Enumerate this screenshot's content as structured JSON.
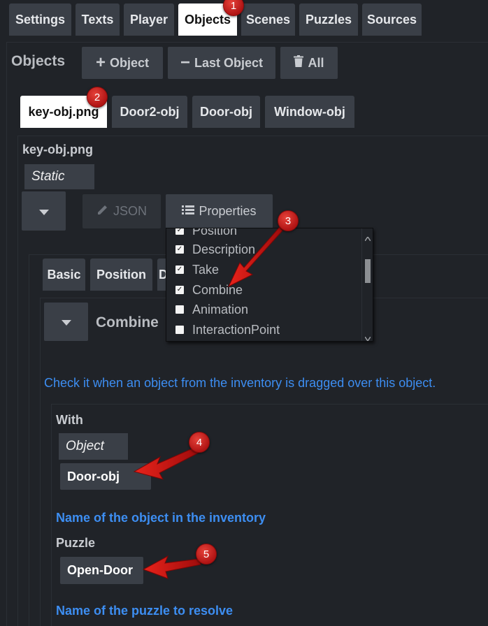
{
  "top_tabs": [
    "Settings",
    "Texts",
    "Player",
    "Objects",
    "Scenes",
    "Puzzles",
    "Sources"
  ],
  "objects_header": {
    "title": "Objects",
    "add_label": "Object",
    "last_label": "Last Object",
    "all_label": "All"
  },
  "object_tabs": [
    "key-obj.png",
    "Door2-obj",
    "Door-obj",
    "Window-obj"
  ],
  "object_panel": {
    "name": "key-obj.png",
    "type_value": "Static",
    "json_label": "JSON",
    "properties_label": "Properties"
  },
  "properties_menu": {
    "items": [
      {
        "label": "Position",
        "checked": true
      },
      {
        "label": "Description",
        "checked": true
      },
      {
        "label": "Take",
        "checked": true
      },
      {
        "label": "Combine",
        "checked": true
      },
      {
        "label": "Animation",
        "checked": false
      },
      {
        "label": "InteractionPoint",
        "checked": false
      }
    ]
  },
  "inner_tabs": [
    "Basic",
    "Position",
    "D"
  ],
  "combine": {
    "title": "Combine",
    "help": "Check it when an object from the inventory is dragged over this object.",
    "with_label": "With",
    "with_type": "Object",
    "with_value": "Door-obj",
    "with_help": "Name of the object in the inventory",
    "puzzle_label": "Puzzle",
    "puzzle_value": "Open-Door",
    "puzzle_help": "Name of the puzzle to resolve"
  },
  "badges": [
    "1",
    "2",
    "3",
    "4",
    "5"
  ],
  "colors": {
    "background": "#202328",
    "button": "#3a3f47",
    "active_tab": "#ffffff",
    "help_text": "#3d8ef2",
    "badge": "#d42a22"
  }
}
